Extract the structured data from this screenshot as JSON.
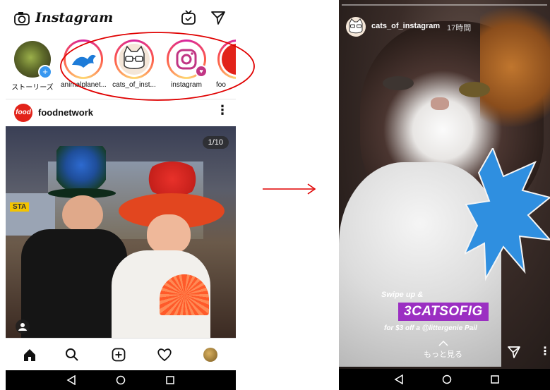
{
  "left_screen": {
    "app_title": "Instagram",
    "stories": [
      {
        "name": "ストーリーズ",
        "own": true
      },
      {
        "name": "animalplanet..."
      },
      {
        "name": "cats_of_inst..."
      },
      {
        "name": "instagram"
      },
      {
        "name": "foo"
      }
    ],
    "post": {
      "username": "foodnetwork",
      "avatar_text": "food",
      "counter": "1/10",
      "sign_text": "STA"
    },
    "bottom_nav": [
      "home-icon",
      "search-icon",
      "add-post-icon",
      "heart-icon",
      "profile-avatar"
    ],
    "annotation_color": "#e00000"
  },
  "right_screen": {
    "username": "cats_of_instagram",
    "time_ago": "17時間",
    "promo": {
      "swipe": "Swipe up &",
      "code": "3CATSOFIG",
      "offer": "for $3 off a @littergenie Pail"
    },
    "see_more": "もっと見る",
    "accent": "#9b2fc2",
    "burst_color": "#2f8fe0"
  }
}
